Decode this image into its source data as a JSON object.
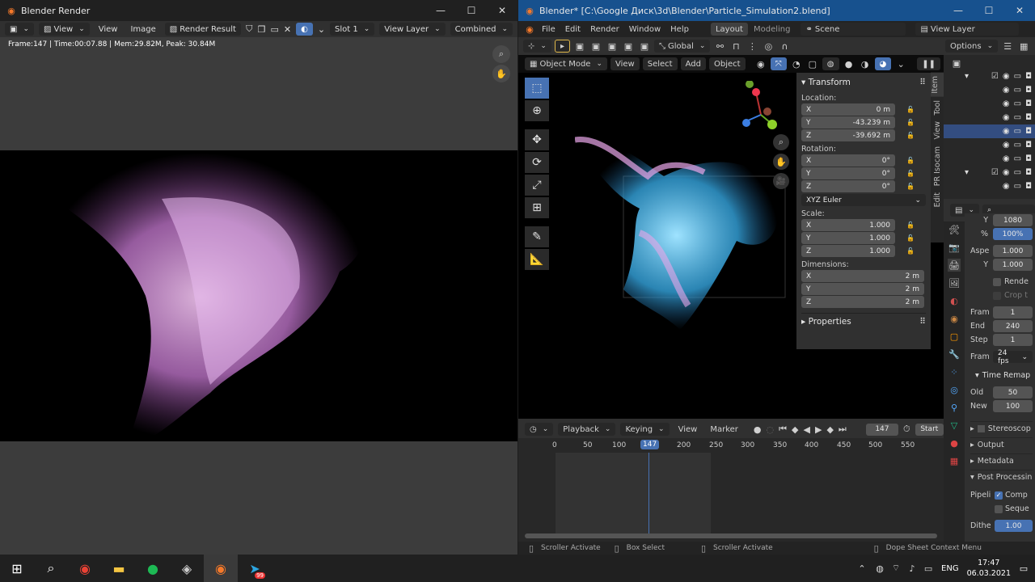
{
  "render_window": {
    "title": "Blender Render",
    "controls": {
      "minimize": "—",
      "maximize": "☐",
      "close": "✕"
    },
    "header": {
      "view": "View",
      "view2": "View",
      "image": "Image",
      "image_name": "Render Result",
      "slot": "Slot 1",
      "view_layer": "View Layer",
      "pass": "Combined"
    },
    "stats": "Frame:147 | Time:00:07.88 | Mem:29.82M, Peak: 30.84M"
  },
  "main_window": {
    "title": "Blender* [C:\\Google Диск\\3d\\Blender\\Particle_Simulation2.blend]",
    "menu": [
      "File",
      "Edit",
      "Render",
      "Window",
      "Help"
    ],
    "workspaces": [
      "Layout",
      "Modeling"
    ],
    "scene": "Scene",
    "view_layer": "View Layer",
    "toolbar": {
      "orientation": "Global",
      "options": "Options"
    },
    "viewport_header": {
      "mode": "Object Mode",
      "view": "View",
      "select": "Select",
      "add": "Add",
      "object": "Object"
    },
    "npanel": {
      "transform_title": "Transform",
      "location_label": "Location:",
      "location": [
        {
          "axis": "X",
          "value": "0 m"
        },
        {
          "axis": "Y",
          "value": "-43.239 m"
        },
        {
          "axis": "Z",
          "value": "-39.692 m"
        }
      ],
      "rotation_label": "Rotation:",
      "rotation": [
        {
          "axis": "X",
          "value": "0°"
        },
        {
          "axis": "Y",
          "value": "0°"
        },
        {
          "axis": "Z",
          "value": "0°"
        }
      ],
      "rotation_mode": "XYZ Euler",
      "scale_label": "Scale:",
      "scale": [
        {
          "axis": "X",
          "value": "1.000"
        },
        {
          "axis": "Y",
          "value": "1.000"
        },
        {
          "axis": "Z",
          "value": "1.000"
        }
      ],
      "dimensions_label": "Dimensions:",
      "dimensions": [
        {
          "axis": "X",
          "value": "2 m"
        },
        {
          "axis": "Y",
          "value": "2 m"
        },
        {
          "axis": "Z",
          "value": "2 m"
        }
      ],
      "properties": "Properties",
      "tabs": [
        "Item",
        "Tool",
        "View",
        "PR Isocam",
        "Edit"
      ]
    },
    "timeline": {
      "playback": "Playback",
      "keying": "Keying",
      "view": "View",
      "marker": "Marker",
      "current_frame": "147",
      "start": "Start",
      "ticks": [
        "0",
        "50",
        "100",
        "147",
        "200",
        "250",
        "300",
        "350",
        "400",
        "450",
        "500",
        "550"
      ]
    },
    "properties": {
      "res_y_label": "Y",
      "res_y": "1080",
      "pct_label": "%",
      "pct": "100%",
      "aspect_label": "Aspe",
      "aspect_x": "1.000",
      "aspect_y_label": "Y",
      "aspect_y": "1.000",
      "render_region": "Rende",
      "crop": "Crop t",
      "frame_start_label": "Fram",
      "frame_start": "1",
      "end_label": "End",
      "frame_end": "240",
      "step_label": "Step",
      "step": "1",
      "fps_label": "Fram",
      "fps": "24 fps",
      "time_remap": "Time Remap",
      "old_label": "Old",
      "old": "50",
      "new_label": "New",
      "new": "100",
      "stereo": "Stereoscop",
      "output": "Output",
      "metadata": "Metadata",
      "post": "Post Processin",
      "pipeline_label": "Pipeli",
      "comp": "Comp",
      "seq": "Seque",
      "dither_label": "Dithe",
      "dither": "1.00"
    },
    "statusbar": {
      "a": "Scroller Activate",
      "b": "Box Select",
      "c": "Scroller Activate",
      "d": "Dope Sheet Context Menu"
    }
  },
  "taskbar": {
    "time": "17:47",
    "date": "06.03.2021",
    "lang": "ENG",
    "badge": "99"
  }
}
